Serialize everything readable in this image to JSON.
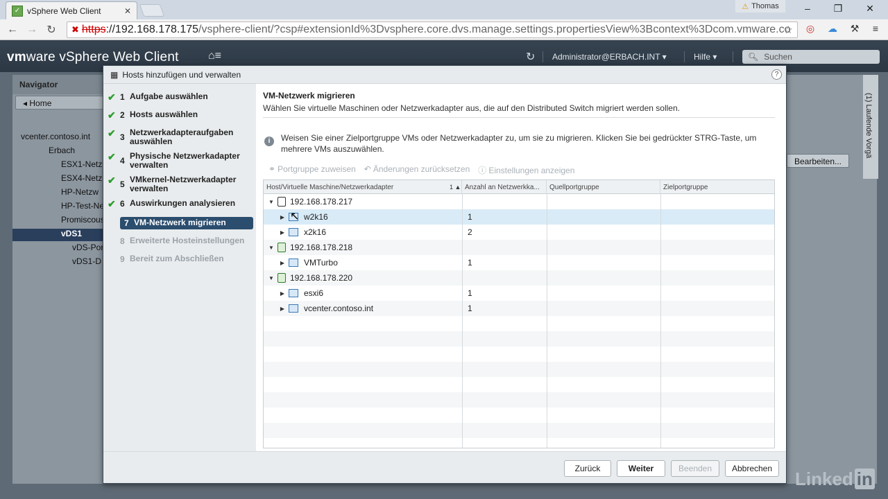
{
  "browser": {
    "tab_title": "vSphere Web Client",
    "user": "Thomas",
    "url_https": "https",
    "url_host": "://192.168.178.175",
    "url_path": "/vsphere-client/?csp#extensionId%3Dvsphere.core.dvs.manage.settings.propertiesView%3Bcontext%3Dcom.vmware.co"
  },
  "vsphere": {
    "brand_bold": "vm",
    "brand_rest": "ware",
    "product": " vSphere Web Client",
    "user": "Administrator@ERBACH.INT ▾",
    "help": "Hilfe ▾",
    "search_placeholder": "Suchen"
  },
  "background": {
    "navigator_title": "Navigator",
    "home": "Home",
    "tree": [
      "vcenter.contoso.int",
      "Erbach",
      "ESX1-Netz",
      "ESX4-Netz",
      "HP-Netzw",
      "HP-Test-Ne",
      "Promiscous",
      "vDS1",
      "vDS-Por",
      "vDS1-D"
    ],
    "edit_button": "Bearbeiten...",
    "right_panel": "(1) Laufende Vorgä"
  },
  "dialog": {
    "title": "Hosts hinzufügen und verwalten",
    "help": "?",
    "steps": [
      {
        "num": "1",
        "label": "Aufgabe auswählen",
        "state": "done"
      },
      {
        "num": "2",
        "label": "Hosts auswählen",
        "state": "done"
      },
      {
        "num": "3",
        "label": "Netzwerkadapteraufgaben auswählen",
        "state": "done"
      },
      {
        "num": "4",
        "label": "Physische Netzwerkadapter verwalten",
        "state": "done"
      },
      {
        "num": "5",
        "label": "VMkernel-Netzwerkadapter verwalten",
        "state": "done"
      },
      {
        "num": "6",
        "label": "Auswirkungen analysieren",
        "state": "done"
      },
      {
        "num": "7",
        "label": "VM-Netzwerk migrieren",
        "state": "current"
      },
      {
        "num": "8",
        "label": "Erweiterte Hosteinstellungen",
        "state": "future"
      },
      {
        "num": "9",
        "label": "Bereit zum Abschließen",
        "state": "future"
      }
    ],
    "content_title": "VM-Netzwerk migrieren",
    "content_subtitle": "Wählen Sie virtuelle Maschinen oder Netzwerkadapter aus, die auf den Distributed Switch migriert werden sollen.",
    "info_text": "Weisen Sie einer Zielportgruppe VMs oder Netzwerkadapter zu, um sie zu migrieren. Klicken Sie bei gedrückter STRG-Taste, um mehrere VMs auszuwählen.",
    "toolbar": {
      "assign": "Portgruppe zuweisen",
      "reset": "Änderungen zurücksetzen",
      "settings": "Einstellungen anzeigen"
    },
    "table": {
      "columns": [
        "Host/Virtuelle Maschine/Netzwerkadapter",
        "Anzahl an Netzwerkka...",
        "Quellportgruppe",
        "Zielportgruppe"
      ],
      "sort_indicator": "1 ▲",
      "rows": [
        {
          "type": "host",
          "name": "192.168.178.217",
          "count": ""
        },
        {
          "type": "vm",
          "name": "w2k16",
          "count": "1"
        },
        {
          "type": "vm",
          "name": "x2k16",
          "count": "2"
        },
        {
          "type": "host",
          "name": "192.168.178.218",
          "count": ""
        },
        {
          "type": "vm",
          "name": "VMTurbo",
          "count": "1"
        },
        {
          "type": "host",
          "name": "192.168.178.220",
          "count": ""
        },
        {
          "type": "vm",
          "name": "esxi6",
          "count": "1"
        },
        {
          "type": "vm",
          "name": "vcenter.contoso.int",
          "count": "1"
        }
      ]
    },
    "buttons": {
      "back": "Zurück",
      "next": "Weiter",
      "finish": "Beenden",
      "cancel": "Abbrechen"
    }
  },
  "watermark": {
    "brand": "Linked",
    "brand_box": "in"
  }
}
